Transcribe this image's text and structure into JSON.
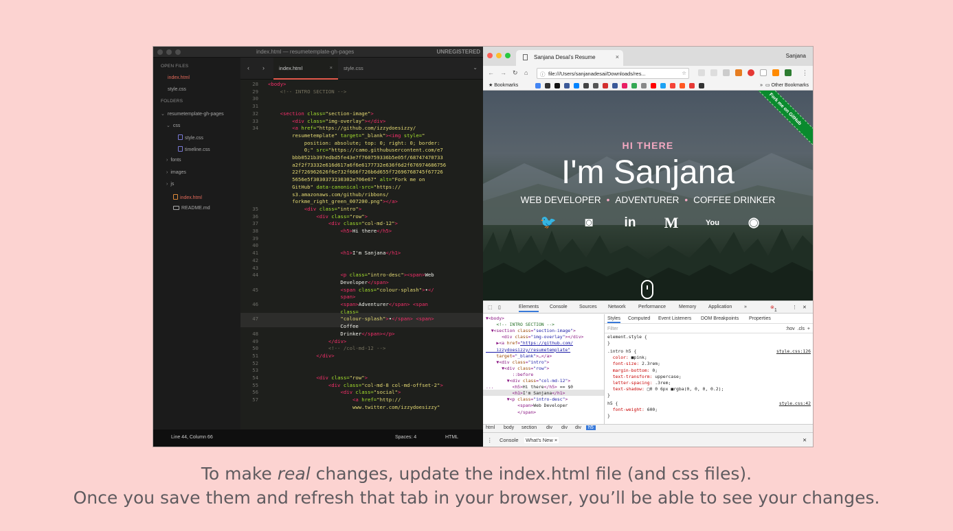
{
  "editor": {
    "title": "index.html — resumetemplate-gh-pages",
    "unregistered": "UNREGISTERED",
    "sidebar": {
      "open_files_header": "OPEN FILES",
      "open_files": [
        "index.html",
        "style.css"
      ],
      "folders_header": "FOLDERS",
      "tree": [
        {
          "label": "resumetemplate-gh-pages",
          "type": "folder-open"
        },
        {
          "label": "css",
          "type": "folder-open"
        },
        {
          "label": "style.css",
          "type": "file"
        },
        {
          "label": "timeline.css",
          "type": "file"
        },
        {
          "label": "fonts",
          "type": "folder"
        },
        {
          "label": "images",
          "type": "folder"
        },
        {
          "label": "js",
          "type": "folder"
        },
        {
          "label": "index.html",
          "type": "file-active"
        },
        {
          "label": "README.md",
          "type": "file"
        }
      ]
    },
    "tabs": [
      {
        "label": "index.html",
        "close": "×"
      },
      {
        "label": "style.css"
      }
    ],
    "status": {
      "position": "Line 44, Column 66",
      "spaces": "Spaces: 4",
      "syntax": "HTML"
    }
  },
  "code_lines": [
    {
      "n": "28",
      "segs": [
        [
          "t",
          "<body>"
        ]
      ]
    },
    {
      "n": "29",
      "segs": [
        [
          "c",
          "    <!-- INTRO SECTION -->"
        ]
      ]
    },
    {
      "n": "30",
      "segs": []
    },
    {
      "n": "31",
      "segs": []
    },
    {
      "n": "32",
      "segs": [
        [
          "p",
          "    "
        ],
        [
          "t",
          "<section"
        ],
        [
          "p",
          " "
        ],
        [
          "a",
          "class="
        ],
        [
          "s",
          "\"section-image\""
        ],
        [
          "t",
          ">"
        ]
      ]
    },
    {
      "n": "33",
      "segs": [
        [
          "p",
          "        "
        ],
        [
          "t",
          "<div"
        ],
        [
          "p",
          " "
        ],
        [
          "a",
          "class="
        ],
        [
          "s",
          "\"img-overlay\""
        ],
        [
          "t",
          "></div>"
        ]
      ]
    },
    {
      "n": "34",
      "segs": [
        [
          "p",
          "        "
        ],
        [
          "t",
          "<a"
        ],
        [
          "p",
          " "
        ],
        [
          "a",
          "href="
        ],
        [
          "s",
          "\"https://github.com/izzydoesizzy/"
        ]
      ]
    },
    {
      "n": "",
      "segs": [
        [
          "s",
          "        resumetemplate\""
        ],
        [
          "p",
          " "
        ],
        [
          "a",
          "target="
        ],
        [
          "s",
          "\"_blank\""
        ],
        [
          "t",
          "><img"
        ],
        [
          "p",
          " "
        ],
        [
          "a",
          "style="
        ],
        [
          "s",
          "\""
        ]
      ]
    },
    {
      "n": "",
      "segs": [
        [
          "s",
          "            position: absolute; top: 0; right: 0; border:"
        ]
      ]
    },
    {
      "n": "",
      "segs": [
        [
          "s",
          "            0;\""
        ],
        [
          "p",
          " "
        ],
        [
          "a",
          "src="
        ],
        [
          "s",
          "\"https://camo.githubusercontent.com/e7"
        ]
      ]
    },
    {
      "n": "",
      "segs": [
        [
          "s",
          "        bbb0521b397edbd5fe43e7f760759336b5e05f/68747470733"
        ]
      ]
    },
    {
      "n": "",
      "segs": [
        [
          "s",
          "        a2f2f73332e616d617a6f6e6177732e636f6d2f676974686756"
        ]
      ]
    },
    {
      "n": "",
      "segs": [
        [
          "s",
          "        22f726962626f6e732f666f726b6d655f72696768745f67726"
        ]
      ]
    },
    {
      "n": "",
      "segs": [
        [
          "s",
          "        5656e5f3030373230302e706e67\""
        ],
        [
          "p",
          " "
        ],
        [
          "a",
          "alt="
        ],
        [
          "s",
          "\"Fork me on"
        ]
      ]
    },
    {
      "n": "",
      "segs": [
        [
          "s",
          "        GitHub\""
        ],
        [
          "p",
          " "
        ],
        [
          "a",
          "data-canonical-src="
        ],
        [
          "s",
          "\"https://"
        ]
      ]
    },
    {
      "n": "",
      "segs": [
        [
          "s",
          "        s3.amazonaws.com/github/ribbons/"
        ]
      ]
    },
    {
      "n": "",
      "segs": [
        [
          "s",
          "        forkme_right_green_007200.png\""
        ],
        [
          "t",
          "></a>"
        ]
      ]
    },
    {
      "n": "35",
      "segs": [
        [
          "p",
          "            "
        ],
        [
          "t",
          "<div"
        ],
        [
          "p",
          " "
        ],
        [
          "a",
          "class="
        ],
        [
          "s",
          "\"intro\""
        ],
        [
          "t",
          ">"
        ]
      ]
    },
    {
      "n": "36",
      "segs": [
        [
          "p",
          "                "
        ],
        [
          "t",
          "<div"
        ],
        [
          "p",
          " "
        ],
        [
          "a",
          "class="
        ],
        [
          "s",
          "\"row\""
        ],
        [
          "t",
          ">"
        ]
      ]
    },
    {
      "n": "37",
      "segs": [
        [
          "p",
          "                    "
        ],
        [
          "t",
          "<div"
        ],
        [
          "p",
          " "
        ],
        [
          "a",
          "class="
        ],
        [
          "s",
          "\"col-md-12\""
        ],
        [
          "t",
          ">"
        ]
      ]
    },
    {
      "n": "38",
      "segs": [
        [
          "p",
          "                        "
        ],
        [
          "t",
          "<h5>"
        ],
        [
          "p",
          "Hi there"
        ],
        [
          "t",
          "</h5>"
        ]
      ]
    },
    {
      "n": "39",
      "segs": []
    },
    {
      "n": "40",
      "segs": []
    },
    {
      "n": "41",
      "segs": [
        [
          "p",
          "                        "
        ],
        [
          "t",
          "<h1>"
        ],
        [
          "p",
          "I'm Sanjana"
        ],
        [
          "t",
          "</h1>"
        ]
      ]
    },
    {
      "n": "42",
      "segs": []
    },
    {
      "n": "43",
      "segs": []
    },
    {
      "n": "44",
      "segs": [
        [
          "p",
          "                        "
        ],
        [
          "t",
          "<p"
        ],
        [
          "p",
          " "
        ],
        [
          "a",
          "class="
        ],
        [
          "s",
          "\"intro-desc\""
        ],
        [
          "t",
          "><span>"
        ],
        [
          "p",
          "Web"
        ]
      ]
    },
    {
      "n": "",
      "segs": [
        [
          "p",
          "                        Developer"
        ],
        [
          "t",
          "</span>"
        ]
      ]
    },
    {
      "n": "45",
      "segs": [
        [
          "p",
          "                        "
        ],
        [
          "t",
          "<span"
        ],
        [
          "p",
          " "
        ],
        [
          "a",
          "class="
        ],
        [
          "s",
          "\"colour-splash\""
        ],
        [
          "t",
          ">"
        ],
        [
          "p",
          "•"
        ],
        [
          "t",
          "</"
        ]
      ]
    },
    {
      "n": "",
      "segs": [
        [
          "t",
          "                        span>"
        ]
      ]
    },
    {
      "n": "46",
      "segs": [
        [
          "p",
          "                        "
        ],
        [
          "t",
          "<span>"
        ],
        [
          "p",
          "Adventurer"
        ],
        [
          "t",
          "</span>"
        ],
        [
          "p",
          " "
        ],
        [
          "t",
          "<span"
        ]
      ]
    },
    {
      "n": "",
      "segs": [
        [
          "a",
          "                        class="
        ]
      ]
    },
    {
      "n": "47",
      "segs": [
        [
          "s",
          "                        \"colour-splash\""
        ],
        [
          "t",
          ">"
        ],
        [
          "p",
          "•"
        ],
        [
          "t",
          "</span>"
        ],
        [
          "p",
          " "
        ],
        [
          "t",
          "<span>"
        ]
      ]
    },
    {
      "n": "",
      "segs": [
        [
          "p",
          "                        Coffee"
        ]
      ]
    },
    {
      "n": "48",
      "segs": [
        [
          "p",
          "                        Drinker"
        ],
        [
          "t",
          "</span></p>"
        ]
      ]
    },
    {
      "n": "49",
      "segs": [
        [
          "p",
          "                    "
        ],
        [
          "t",
          "</div>"
        ]
      ]
    },
    {
      "n": "50",
      "segs": [
        [
          "c",
          "                    <!-- /col-md-12 -->"
        ]
      ]
    },
    {
      "n": "51",
      "segs": [
        [
          "p",
          "                "
        ],
        [
          "t",
          "</div>"
        ]
      ]
    },
    {
      "n": "52",
      "segs": []
    },
    {
      "n": "53",
      "segs": []
    },
    {
      "n": "54",
      "segs": [
        [
          "p",
          "                "
        ],
        [
          "t",
          "<div"
        ],
        [
          "p",
          " "
        ],
        [
          "a",
          "class="
        ],
        [
          "s",
          "\"row\""
        ],
        [
          "t",
          ">"
        ]
      ]
    },
    {
      "n": "55",
      "segs": [
        [
          "p",
          "                    "
        ],
        [
          "t",
          "<div"
        ],
        [
          "p",
          " "
        ],
        [
          "a",
          "class="
        ],
        [
          "s",
          "\"col-md-8 col-md-offset-2\""
        ],
        [
          "t",
          ">"
        ]
      ]
    },
    {
      "n": "56",
      "segs": [
        [
          "p",
          "                        "
        ],
        [
          "t",
          "<div"
        ],
        [
          "p",
          " "
        ],
        [
          "a",
          "class="
        ],
        [
          "s",
          "\"social\""
        ],
        [
          "t",
          ">"
        ]
      ]
    },
    {
      "n": "57",
      "segs": [
        [
          "p",
          "                            "
        ],
        [
          "t",
          "<a"
        ],
        [
          "p",
          " "
        ],
        [
          "a",
          "href="
        ],
        [
          "s",
          "\"http://"
        ]
      ]
    },
    {
      "n": "",
      "segs": [
        [
          "s",
          "                            www.twitter.com/izzydoesizzy\""
        ]
      ]
    }
  ],
  "browser": {
    "tab_title": "Sanjana Desai's Resume",
    "tab_close": "×",
    "user": "Sanjana",
    "url": "file:///Users/sanjanadesai/Downloads/res...",
    "bookmarks_label": "Bookmarks",
    "other_bookmarks": "Other Bookmarks",
    "overflow": "»",
    "page": {
      "ribbon": "Fork me on GitHub",
      "h5": "HI THERE",
      "h1": "I'm Sanjana",
      "desc": [
        "WEB DEVELOPER",
        "ADVENTURER",
        "COFFEE DRINKER"
      ],
      "separator": "•",
      "social_icons": [
        "twitter-icon",
        "instagram-icon",
        "linkedin-icon",
        "medium-icon",
        "youtube-icon",
        "github-icon"
      ],
      "social_glyphs": [
        "🐦",
        "◙",
        "in",
        "M",
        "You",
        "◉"
      ]
    }
  },
  "devtools": {
    "tabs": [
      "Elements",
      "Console",
      "Sources",
      "Network",
      "Performance",
      "Memory",
      "Application",
      "»"
    ],
    "error_count": "1",
    "styles_tabs": [
      "Styles",
      "Computed",
      "Event Listeners",
      "DOM Breakpoints",
      "Properties"
    ],
    "filter_placeholder": "Filter",
    "filter_tools": ":hov  .cls  +",
    "breadcrumbs": [
      "html",
      "body",
      "section",
      "div",
      "div",
      "div",
      "h5"
    ],
    "drawer_tabs": [
      "Console",
      "What's New ×"
    ]
  },
  "dom_lines": [
    [
      [
        "tg",
        "▼<body>"
      ]
    ],
    [
      [
        "cm",
        "    <!-- INTRO SECTION -->"
      ]
    ],
    [
      [
        "tg",
        "  ▼<section "
      ],
      [
        "at",
        "class"
      ],
      [
        "tg",
        "="
      ],
      [
        "av",
        "\"section-image\""
      ],
      [
        "tg",
        ">"
      ]
    ],
    [
      [
        "tg",
        "      <div "
      ],
      [
        "at",
        "class"
      ],
      [
        "tg",
        "="
      ],
      [
        "av",
        "\"img-overlay\""
      ],
      [
        "tg",
        "></div>"
      ]
    ],
    [
      [
        "tg",
        "    ▶<a "
      ],
      [
        "at",
        "href"
      ],
      [
        "tg",
        "="
      ],
      [
        "lk",
        "\"https://github.com/"
      ]
    ],
    [
      [
        "lk",
        "    izzydoesizzy/resumetemplate\""
      ]
    ],
    [
      [
        "at",
        "    target"
      ],
      [
        "tg",
        "="
      ],
      [
        "av",
        "\"_blank\""
      ],
      [
        "tg",
        ">…</a>"
      ]
    ],
    [
      [
        "tg",
        "    ▼<div "
      ],
      [
        "at",
        "class"
      ],
      [
        "tg",
        "="
      ],
      [
        "av",
        "\"intro\""
      ],
      [
        "tg",
        ">"
      ]
    ],
    [
      [
        "tg",
        "      ▼<div "
      ],
      [
        "at",
        "class"
      ],
      [
        "tg",
        "="
      ],
      [
        "av",
        "\"row\""
      ],
      [
        "tg",
        ">"
      ]
    ],
    [
      [
        "tg",
        "          ::before"
      ]
    ],
    [
      [
        "tg",
        "        ▼<div "
      ],
      [
        "at",
        "class"
      ],
      [
        "tg",
        "="
      ],
      [
        "av",
        "\"col-md-12\""
      ],
      [
        "tg",
        ">"
      ]
    ],
    [
      [
        "tg",
        "...       <h5>"
      ],
      [
        "p",
        "Hi there"
      ],
      [
        "tg",
        "</h5>"
      ],
      [
        "p",
        " == $0"
      ]
    ],
    [
      [
        "tg",
        "          <h1>"
      ],
      [
        "p",
        "I'm Sanjana"
      ],
      [
        "tg",
        "</h1>"
      ]
    ],
    [
      [
        "tg",
        "        ▼<p "
      ],
      [
        "at",
        "class"
      ],
      [
        "tg",
        "="
      ],
      [
        "av",
        "\"intro-desc\""
      ],
      [
        "tg",
        ">"
      ]
    ],
    [
      [
        "tg",
        "            <span>"
      ],
      [
        "p",
        "Web Developer"
      ]
    ],
    [
      [
        "tg",
        "            </span>"
      ]
    ]
  ],
  "style_lines": [
    {
      "text": "element.style {",
      "src": ""
    },
    {
      "text": "}",
      "src": ""
    },
    {
      "text": ".intro h5 {",
      "src": "style.css:126"
    },
    {
      "text": "  color: ■pink;",
      "src": ""
    },
    {
      "text": "  font-size: 2.3rem;",
      "src": ""
    },
    {
      "text": "  margin-bottom: 0;",
      "src": ""
    },
    {
      "text": "  text-transform: uppercase;",
      "src": ""
    },
    {
      "text": "  letter-spacing: .3rem;",
      "src": ""
    },
    {
      "text": "  text-shadow: □0 0 6px ■rgba(0, 0, 0, 0.2);",
      "src": ""
    },
    {
      "text": "}",
      "src": ""
    },
    {
      "text": "h5 {",
      "src": "style.css:42"
    },
    {
      "text": "  font-weight: 600;",
      "src": ""
    },
    {
      "text": "}",
      "src": ""
    }
  ],
  "caption": {
    "line1_pre": "To make ",
    "line1_em": "real",
    "line1_post": " changes, update the index.html file (and css files).",
    "line2": "Once you save them and refresh that tab in your browser, you’ll be able to see your changes."
  },
  "colors": {
    "background": "#fcd3d1",
    "accent_pink": "#f4a9c2",
    "ribbon_green": "#0a8a2e",
    "tab_underline": "#e3584a"
  }
}
